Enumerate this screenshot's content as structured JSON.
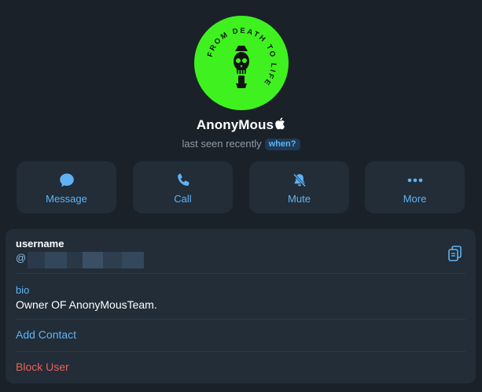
{
  "profile": {
    "name": "AnonyMous",
    "status": "last seen recently",
    "when_badge": "when?",
    "avatar_text": "FROM DEATH TO LIFE"
  },
  "actions": [
    {
      "label": "Message",
      "icon": "message-bubble-icon"
    },
    {
      "label": "Call",
      "icon": "phone-icon"
    },
    {
      "label": "Mute",
      "icon": "bell-off-icon"
    },
    {
      "label": "More",
      "icon": "more-dots-icon"
    }
  ],
  "info": {
    "username_label": "username",
    "username_prefix": "@",
    "bio_label": "bio",
    "bio_text": "Owner OF AnonyMousTeam.",
    "add_contact": "Add Contact",
    "block_user": "Block User"
  },
  "colors": {
    "background": "#1a2129",
    "card": "#222d38",
    "accent": "#5fb3f5",
    "danger": "#e8615a",
    "avatar": "#3ff21f"
  }
}
